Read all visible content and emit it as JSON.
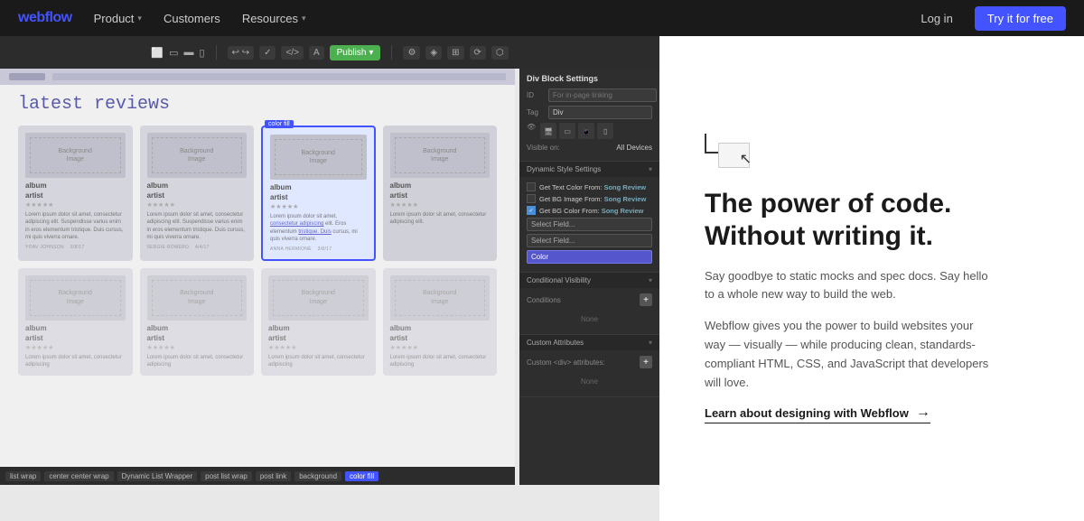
{
  "nav": {
    "logo": "webflow",
    "items": [
      {
        "label": "Product",
        "has_dropdown": true
      },
      {
        "label": "Customers",
        "has_dropdown": false
      },
      {
        "label": "Resources",
        "has_dropdown": true
      }
    ],
    "login_label": "Log in",
    "cta_label": "Try it for free"
  },
  "editor": {
    "toolbar": {
      "publish_label": "Publish",
      "device_icons": [
        "desktop",
        "tablet",
        "phone-landscape",
        "phone-portrait"
      ]
    },
    "canvas": {
      "latest_reviews_title": "latest reviews",
      "cards": [
        {
          "album": "album",
          "artist": "artist",
          "stars": "★★★★★",
          "text": "Lorem ipsum dolor sit amet, consectetur adipiscing elit. Suspendisse varius enim in eros elementum tristique. Duis cursus, mi quis viverra ornare.",
          "author": "YOAV JOHNSON",
          "date": "3/8/17",
          "selected": false
        },
        {
          "album": "album",
          "artist": "artist",
          "stars": "★★★★★",
          "text": "Lorem ipsum dolor sit amet, consectetur adipiscing elit. Suspendisse varius enim in eros elementum tristique. Duis cursus, mi quis viverra ornare.",
          "author": "SERGIE ROMERO",
          "date": "4/4/17",
          "selected": false
        },
        {
          "album": "album",
          "artist": "artist",
          "stars": "★★★★★",
          "text": "Lorem ipsum dolor sit amet, consectetur adipiscing elit. Suspendisse varius enim in eros elementum tristique. Duis cursus, mi quis viverra ornare.",
          "author": "ANNA HERMIONE",
          "date": "3/8/17",
          "selected": true,
          "color_fill": "color fill"
        },
        {
          "album": "album",
          "artist": "artist",
          "stars": "★★★★★",
          "text": "Lorem ipsum dolor sit amet, consectetur adipiscing elit.",
          "author": "",
          "date": "",
          "selected": false
        }
      ],
      "bottom_row_cards": [
        {
          "selected": false
        },
        {
          "selected": false
        },
        {
          "selected": false
        },
        {
          "selected": false
        }
      ]
    },
    "tag_bar": [
      {
        "label": "list wrap",
        "active": false
      },
      {
        "label": "center center wrap",
        "active": false
      },
      {
        "label": "Dynamic List Wrapper",
        "active": false
      },
      {
        "label": "post list wrap",
        "active": false
      },
      {
        "label": "post link",
        "active": false
      },
      {
        "label": "background",
        "active": false
      },
      {
        "label": "color fill",
        "active": true
      }
    ]
  },
  "settings_panel": {
    "title": "Div Block Settings",
    "id_label": "ID",
    "id_placeholder": "For in-page linking",
    "tag_label": "Tag",
    "tag_value": "Div",
    "visibility_label": "Visible on:",
    "visibility_value": "All Devices",
    "dynamic_style_title": "Dynamic Style Settings",
    "dynamic_rows": [
      {
        "checked": false,
        "text": "Get Text Color From:",
        "source": "Song Review"
      },
      {
        "checked": false,
        "text": "Get BG Image From:",
        "source": "Song Review"
      },
      {
        "checked": true,
        "text": "Get BG Color From:",
        "source": "Song Review"
      }
    ],
    "field_options": [
      "Select Field...",
      "Color"
    ],
    "field_selected": "Color",
    "conditional_title": "Conditional Visibility",
    "conditions_label": "Conditions",
    "conditions_none": "None",
    "custom_attrs_title": "Custom Attributes",
    "custom_div_label": "Custom <div> attributes:",
    "custom_none": "None"
  },
  "right_content": {
    "headline": "The power of code.\nWithout writing it.",
    "desc1": "Say goodbye to static mocks and spec docs. Say hello to a whole new way to build the web.",
    "desc2": "Webflow gives you the power to build websites your way — visually — while producing clean, standards-compliant HTML, CSS, and JavaScript that developers will love.",
    "learn_link": "Learn about designing with Webflow"
  }
}
